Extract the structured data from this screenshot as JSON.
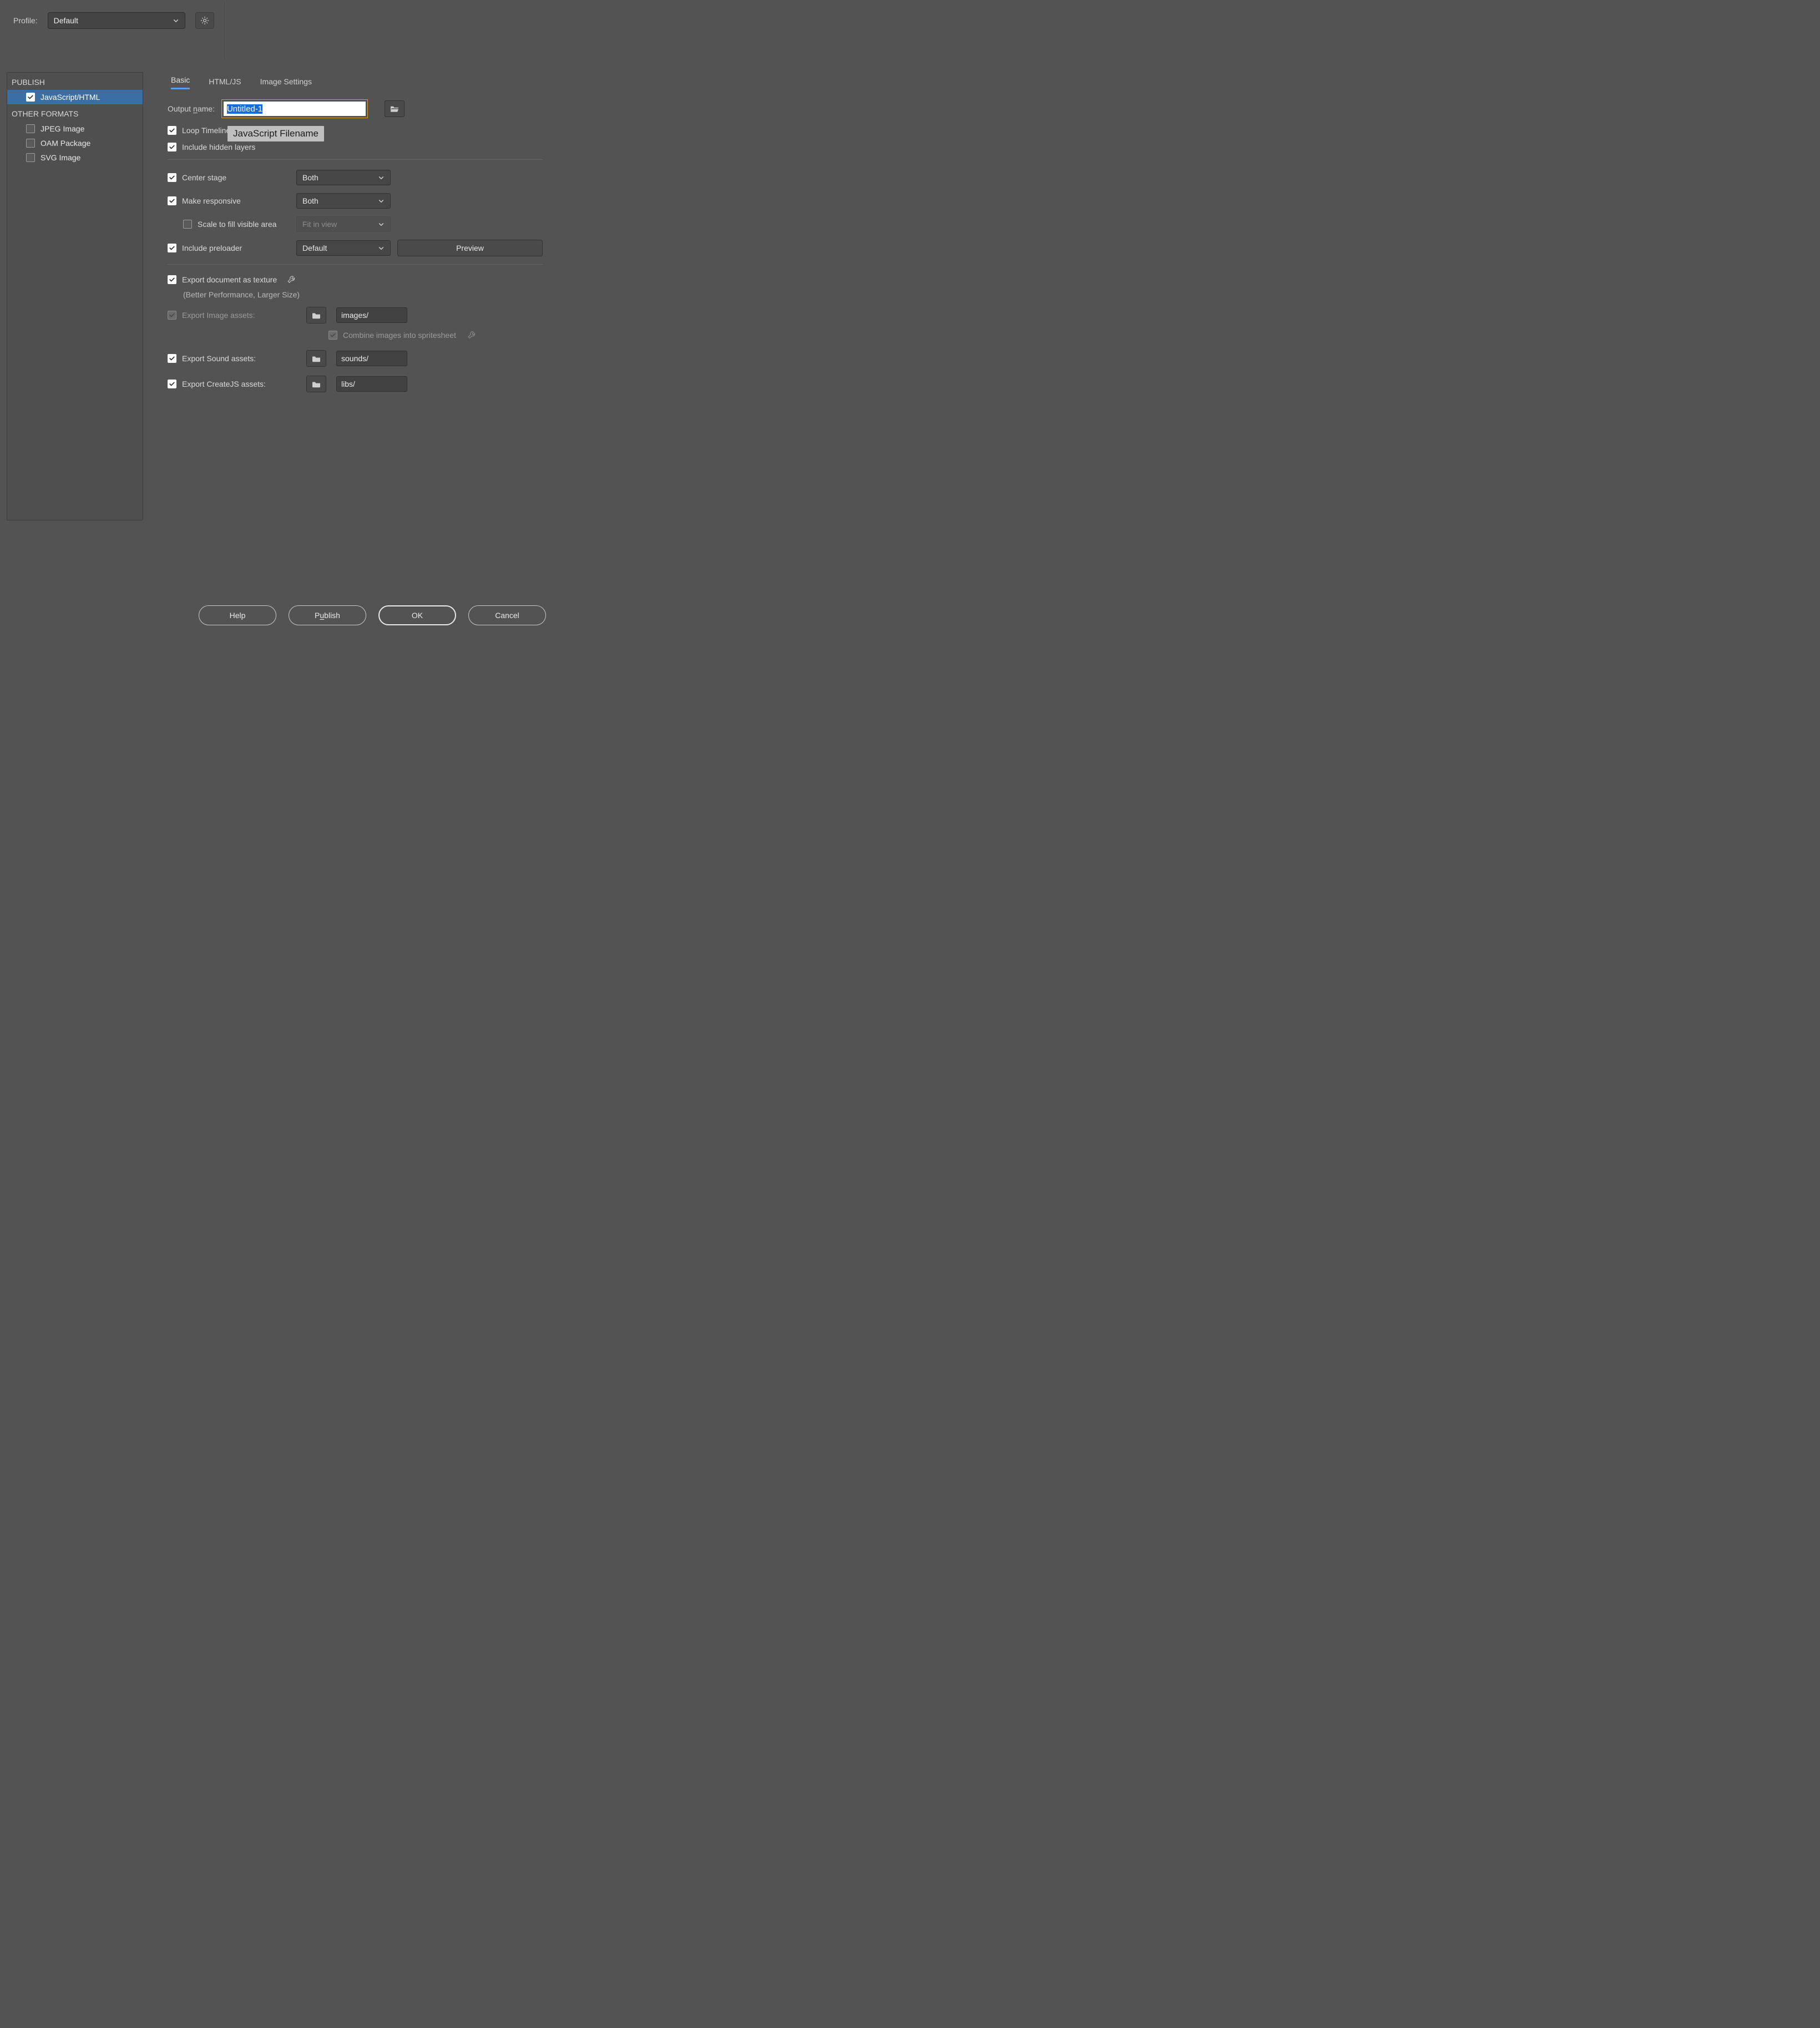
{
  "topbar": {
    "profile_label": "Profile:",
    "profile_value": "Default"
  },
  "sidebar": {
    "heading_publish": "PUBLISH",
    "heading_other": "OTHER FORMATS",
    "items": [
      {
        "label": "JavaScript/HTML",
        "checked": true,
        "selected": true
      },
      {
        "label": "JPEG Image",
        "checked": false,
        "selected": false
      },
      {
        "label": "OAM Package",
        "checked": false,
        "selected": false
      },
      {
        "label": "SVG Image",
        "checked": false,
        "selected": false
      }
    ]
  },
  "tabs": {
    "basic": "Basic",
    "htmljs": "HTML/JS",
    "image_settings": "Image Settings"
  },
  "output": {
    "label_pre": "Output",
    "label_underlined": "n",
    "label_post": "ame:",
    "value": "Untitled-1",
    "tooltip": "JavaScript Filename"
  },
  "options": {
    "loop_timeline": "Loop Timeline",
    "include_hidden": "Include hidden layers",
    "center_stage": "Center stage",
    "center_stage_value": "Both",
    "make_responsive": "Make responsive",
    "make_responsive_value": "Both",
    "scale_fill": "Scale to fill visible area",
    "scale_fill_value": "Fit in view",
    "include_preloader": "Include preloader",
    "preloader_value": "Default",
    "preview": "Preview",
    "export_texture": "Export document as texture",
    "export_texture_note": "(Better Performance, Larger Size)",
    "export_image_assets": "Export Image assets:",
    "images_path": "images/",
    "combine_spritesheet": "Combine images into spritesheet",
    "export_sound_assets": "Export Sound assets:",
    "sounds_path": "sounds/",
    "export_createjs_assets": "Export CreateJS assets:",
    "libs_path": "libs/"
  },
  "footer": {
    "help": "Help",
    "publish_pre": "P",
    "publish_u": "u",
    "publish_post": "blish",
    "ok": "OK",
    "cancel": "Cancel"
  }
}
